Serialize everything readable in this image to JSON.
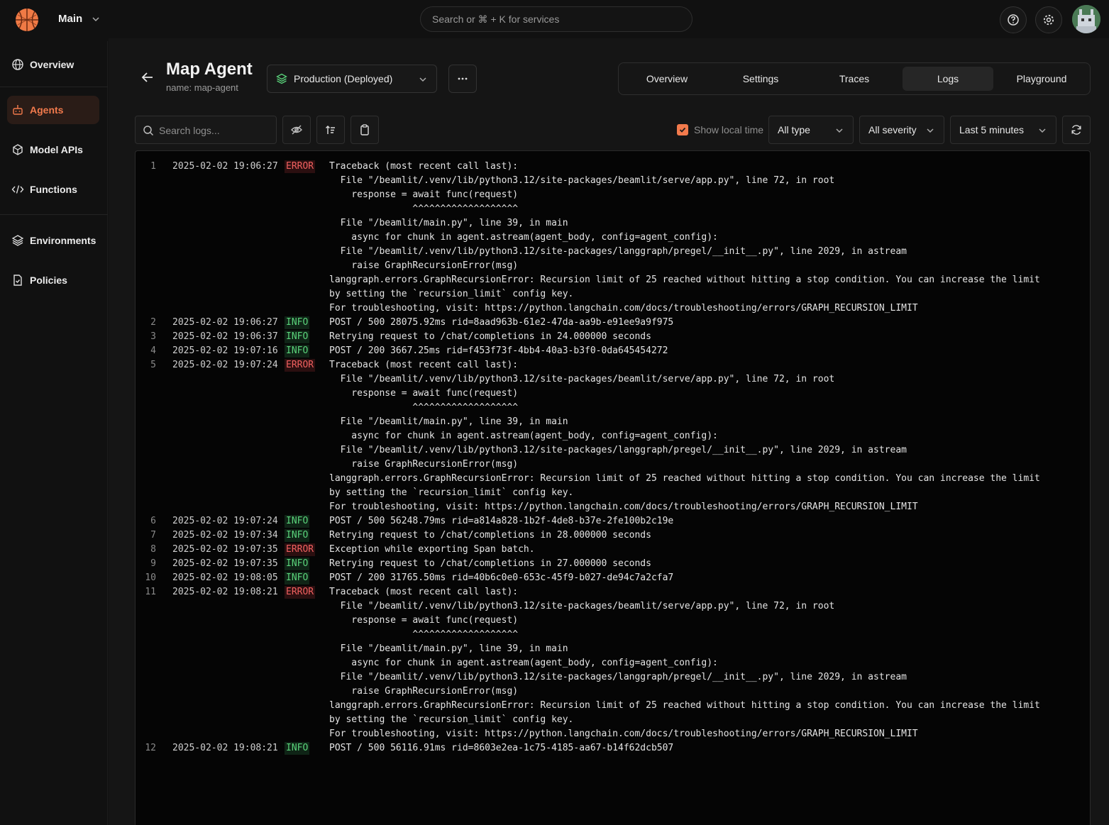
{
  "topbar": {
    "workspace": "Main",
    "search_placeholder": "Search or ⌘ + K for services"
  },
  "sidebar": {
    "items": [
      {
        "label": "Overview",
        "icon": "globe-icon"
      },
      {
        "label": "Agents",
        "icon": "robot-icon",
        "active": true
      },
      {
        "label": "Model APIs",
        "icon": "cube-icon"
      },
      {
        "label": "Functions",
        "icon": "code-icon"
      },
      {
        "label": "Environments",
        "icon": "layers-icon"
      },
      {
        "label": "Policies",
        "icon": "file-check-icon"
      }
    ]
  },
  "agent": {
    "title": "Map Agent",
    "subtitle": "name: map-agent",
    "environment": "Production (Deployed)"
  },
  "tabs": [
    "Overview",
    "Settings",
    "Traces",
    "Logs",
    "Playground"
  ],
  "active_tab": "Logs",
  "toolbar": {
    "search_placeholder": "Search logs...",
    "show_local_time_label": "Show local time",
    "show_local_time_checked": true,
    "type_filter": "All type",
    "severity_filter": "All severity",
    "time_range": "Last 5 minutes"
  },
  "colors": {
    "accent": "#f27a4c",
    "error": "#f0605f",
    "info": "#5ad27a"
  },
  "logs": [
    {
      "n": "1",
      "ts": "2025-02-02 19:06:27",
      "level": "ERROR",
      "lines": [
        "Traceback (most recent call last):",
        "  File \"/beamlit/.venv/lib/python3.12/site-packages/beamlit/serve/app.py\", line 72, in root",
        "    response = await func(request)",
        "               ^^^^^^^^^^^^^^^^^^^",
        "  File \"/beamlit/main.py\", line 39, in main",
        "    async for chunk in agent.astream(agent_body, config=agent_config):",
        "  File \"/beamlit/.venv/lib/python3.12/site-packages/langgraph/pregel/__init__.py\", line 2029, in astream",
        "    raise GraphRecursionError(msg)",
        "langgraph.errors.GraphRecursionError: Recursion limit of 25 reached without hitting a stop condition. You can increase the limit",
        "by setting the `recursion_limit` config key.",
        "For troubleshooting, visit: https://python.langchain.com/docs/troubleshooting/errors/GRAPH_RECURSION_LIMIT"
      ]
    },
    {
      "n": "2",
      "ts": "2025-02-02 19:06:27",
      "level": "INFO",
      "lines": [
        "POST / 500 28075.92ms rid=8aad963b-61e2-47da-aa9b-e91ee9a9f975"
      ]
    },
    {
      "n": "3",
      "ts": "2025-02-02 19:06:37",
      "level": "INFO",
      "lines": [
        "Retrying request to /chat/completions in 24.000000 seconds"
      ]
    },
    {
      "n": "4",
      "ts": "2025-02-02 19:07:16",
      "level": "INFO",
      "lines": [
        "POST / 200 3667.25ms rid=f453f73f-4bb4-40a3-b3f0-0da645454272"
      ]
    },
    {
      "n": "5",
      "ts": "2025-02-02 19:07:24",
      "level": "ERROR",
      "lines": [
        "Traceback (most recent call last):",
        "  File \"/beamlit/.venv/lib/python3.12/site-packages/beamlit/serve/app.py\", line 72, in root",
        "    response = await func(request)",
        "               ^^^^^^^^^^^^^^^^^^^",
        "  File \"/beamlit/main.py\", line 39, in main",
        "    async for chunk in agent.astream(agent_body, config=agent_config):",
        "  File \"/beamlit/.venv/lib/python3.12/site-packages/langgraph/pregel/__init__.py\", line 2029, in astream",
        "    raise GraphRecursionError(msg)",
        "langgraph.errors.GraphRecursionError: Recursion limit of 25 reached without hitting a stop condition. You can increase the limit",
        "by setting the `recursion_limit` config key.",
        "For troubleshooting, visit: https://python.langchain.com/docs/troubleshooting/errors/GRAPH_RECURSION_LIMIT"
      ]
    },
    {
      "n": "6",
      "ts": "2025-02-02 19:07:24",
      "level": "INFO",
      "lines": [
        "POST / 500 56248.79ms rid=a814a828-1b2f-4de8-b37e-2fe100b2c19e"
      ]
    },
    {
      "n": "7",
      "ts": "2025-02-02 19:07:34",
      "level": "INFO",
      "lines": [
        "Retrying request to /chat/completions in 28.000000 seconds"
      ]
    },
    {
      "n": "8",
      "ts": "2025-02-02 19:07:35",
      "level": "ERROR",
      "lines": [
        "Exception while exporting Span batch."
      ]
    },
    {
      "n": "9",
      "ts": "2025-02-02 19:07:35",
      "level": "INFO",
      "lines": [
        "Retrying request to /chat/completions in 27.000000 seconds"
      ]
    },
    {
      "n": "10",
      "ts": "2025-02-02 19:08:05",
      "level": "INFO",
      "lines": [
        "POST / 200 31765.50ms rid=40b6c0e0-653c-45f9-b027-de94c7a2cfa7"
      ]
    },
    {
      "n": "11",
      "ts": "2025-02-02 19:08:21",
      "level": "ERROR",
      "lines": [
        "Traceback (most recent call last):",
        "  File \"/beamlit/.venv/lib/python3.12/site-packages/beamlit/serve/app.py\", line 72, in root",
        "    response = await func(request)",
        "               ^^^^^^^^^^^^^^^^^^^",
        "  File \"/beamlit/main.py\", line 39, in main",
        "    async for chunk in agent.astream(agent_body, config=agent_config):",
        "  File \"/beamlit/.venv/lib/python3.12/site-packages/langgraph/pregel/__init__.py\", line 2029, in astream",
        "    raise GraphRecursionError(msg)",
        "langgraph.errors.GraphRecursionError: Recursion limit of 25 reached without hitting a stop condition. You can increase the limit",
        "by setting the `recursion_limit` config key.",
        "For troubleshooting, visit: https://python.langchain.com/docs/troubleshooting/errors/GRAPH_RECURSION_LIMIT"
      ]
    },
    {
      "n": "12",
      "ts": "2025-02-02 19:08:21",
      "level": "INFO",
      "lines": [
        "POST / 500 56116.91ms rid=8603e2ea-1c75-4185-aa67-b14f62dcb507"
      ]
    }
  ]
}
